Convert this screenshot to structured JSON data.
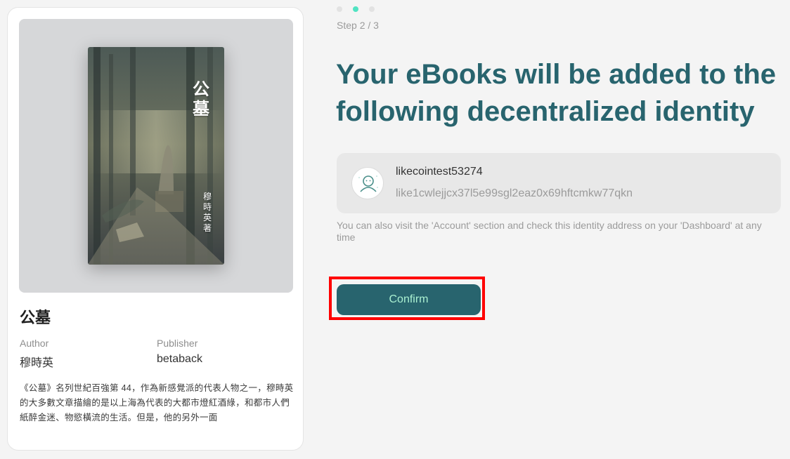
{
  "book": {
    "cover_title": "公墓",
    "cover_author": "穆時英 著",
    "title": "公墓",
    "author_label": "Author",
    "author": "穆時英",
    "publisher_label": "Publisher",
    "publisher": "betaback",
    "description": "《公墓》名列世紀百強第 44，作為新感覺派的代表人物之一，穆時英的大多數文章描繪的是以上海為代表的大都市燈紅酒綠，和都市人們紙醉金迷、物慾橫流的生活。但是，他的另外一面"
  },
  "stepper": {
    "total_dots": 3,
    "active_index": 1,
    "label": "Step 2 / 3"
  },
  "headline": "Your eBooks will be added to the following decentralized identity",
  "identity": {
    "name": "likecointest53274",
    "address": "like1cwlejjcx37l5e99sgl2eaz0x69hftcmkw77qkn",
    "avatar_icon": "default-avatar-icon"
  },
  "hint": "You can also visit the 'Account' section and check this identity address on your 'Dashboard' at any time",
  "confirm_label": "Confirm",
  "colors": {
    "accent": "#28646e",
    "accent_text": "#aaf0d1",
    "active_dot": "#50e3c2",
    "highlight": "#ff0000"
  }
}
